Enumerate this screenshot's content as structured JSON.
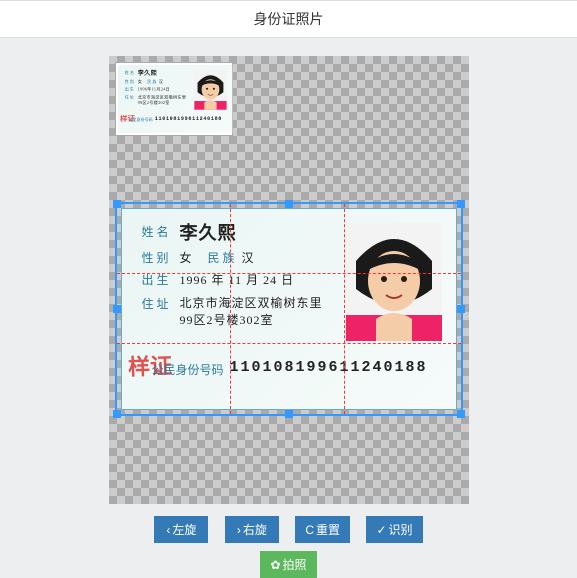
{
  "header": {
    "title": "身份证照片"
  },
  "id_card": {
    "labels": {
      "name": "姓 名",
      "sex": "性 别",
      "nation": "民 族",
      "dob": "出 生",
      "addr": "住 址",
      "idno": "公民身份号码"
    },
    "name": "李久熙",
    "sex": "女",
    "nation": "汉",
    "dob_y": "1996",
    "dob_m": "11",
    "dob_d": "24",
    "dob_sep_y": "年",
    "dob_sep_m": "月",
    "dob_sep_d": "日",
    "addr_line1": "北京市海淀区双榆树东里",
    "addr_line2": "99区2号楼302室",
    "idno": "110108199611240188",
    "stamp": "样证"
  },
  "buttons": {
    "rotate_left": "左旋",
    "rotate_right": "右旋",
    "reset": "重置",
    "recognize": "识别",
    "capture": "拍照"
  },
  "icons": {
    "chevron_left": "‹",
    "chevron_right": "›",
    "reset": "C",
    "check": "✓",
    "camera": "✿"
  }
}
